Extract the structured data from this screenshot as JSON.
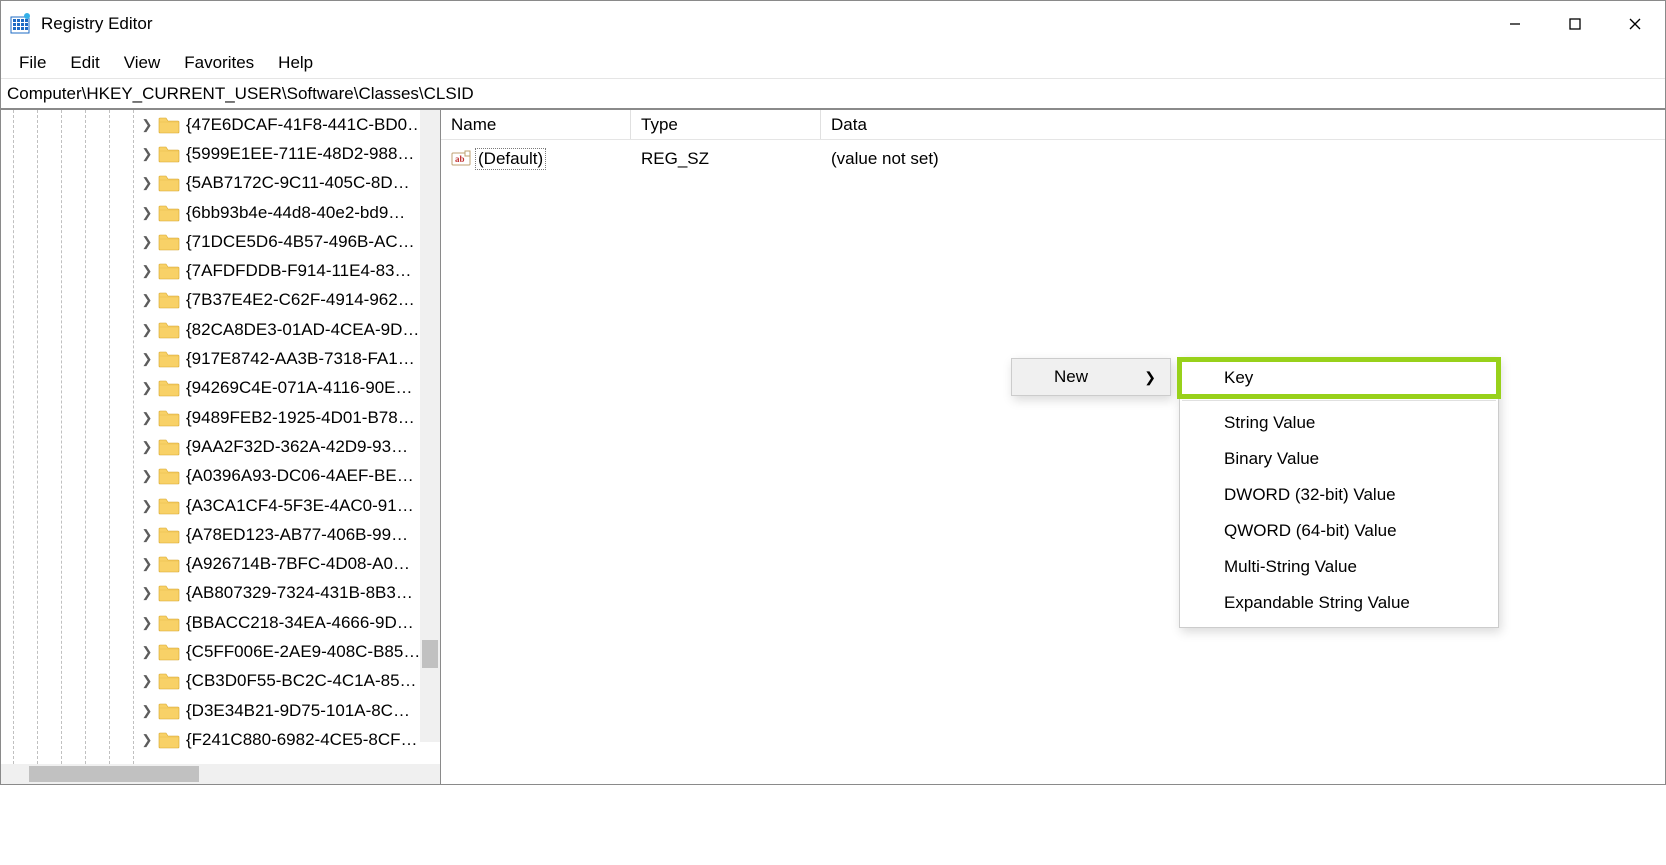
{
  "title": "Registry Editor",
  "menus": [
    "File",
    "Edit",
    "View",
    "Favorites",
    "Help"
  ],
  "path": "Computer\\HKEY_CURRENT_USER\\Software\\Classes\\CLSID",
  "tree_items": [
    "{47E6DCAF-41F8-441C-BD0…",
    "{5999E1EE-711E-48D2-988…",
    "{5AB7172C-9C11-405C-8D…",
    "{6bb93b4e-44d8-40e2-bd9…",
    "{71DCE5D6-4B57-496B-AC…",
    "{7AFDFDDB-F914-11E4-83…",
    "{7B37E4E2-C62F-4914-962…",
    "{82CA8DE3-01AD-4CEA-9D…",
    "{917E8742-AA3B-7318-FA1…",
    "{94269C4E-071A-4116-90E…",
    "{9489FEB2-1925-4D01-B78…",
    "{9AA2F32D-362A-42D9-93…",
    "{A0396A93-DC06-4AEF-BE…",
    "{A3CA1CF4-5F3E-4AC0-91…",
    "{A78ED123-AB77-406B-99…",
    "{A926714B-7BFC-4D08-A0…",
    "{AB807329-7324-431B-8B3…",
    "{BBACC218-34EA-4666-9D…",
    "{C5FF006E-2AE9-408C-B85…",
    "{CB3D0F55-BC2C-4C1A-85…",
    "{D3E34B21-9D75-101A-8C…",
    "{F241C880-6982-4CE5-8CF…"
  ],
  "details": {
    "cols": [
      "Name",
      "Type",
      "Data"
    ],
    "rows": [
      {
        "name": "(Default)",
        "type": "REG_SZ",
        "data": "(value not set)",
        "selected": true
      }
    ]
  },
  "ctx1": {
    "label": "New"
  },
  "ctx2": [
    "Key",
    "String Value",
    "Binary Value",
    "DWORD (32-bit) Value",
    "QWORD (64-bit) Value",
    "Multi-String Value",
    "Expandable String Value"
  ]
}
